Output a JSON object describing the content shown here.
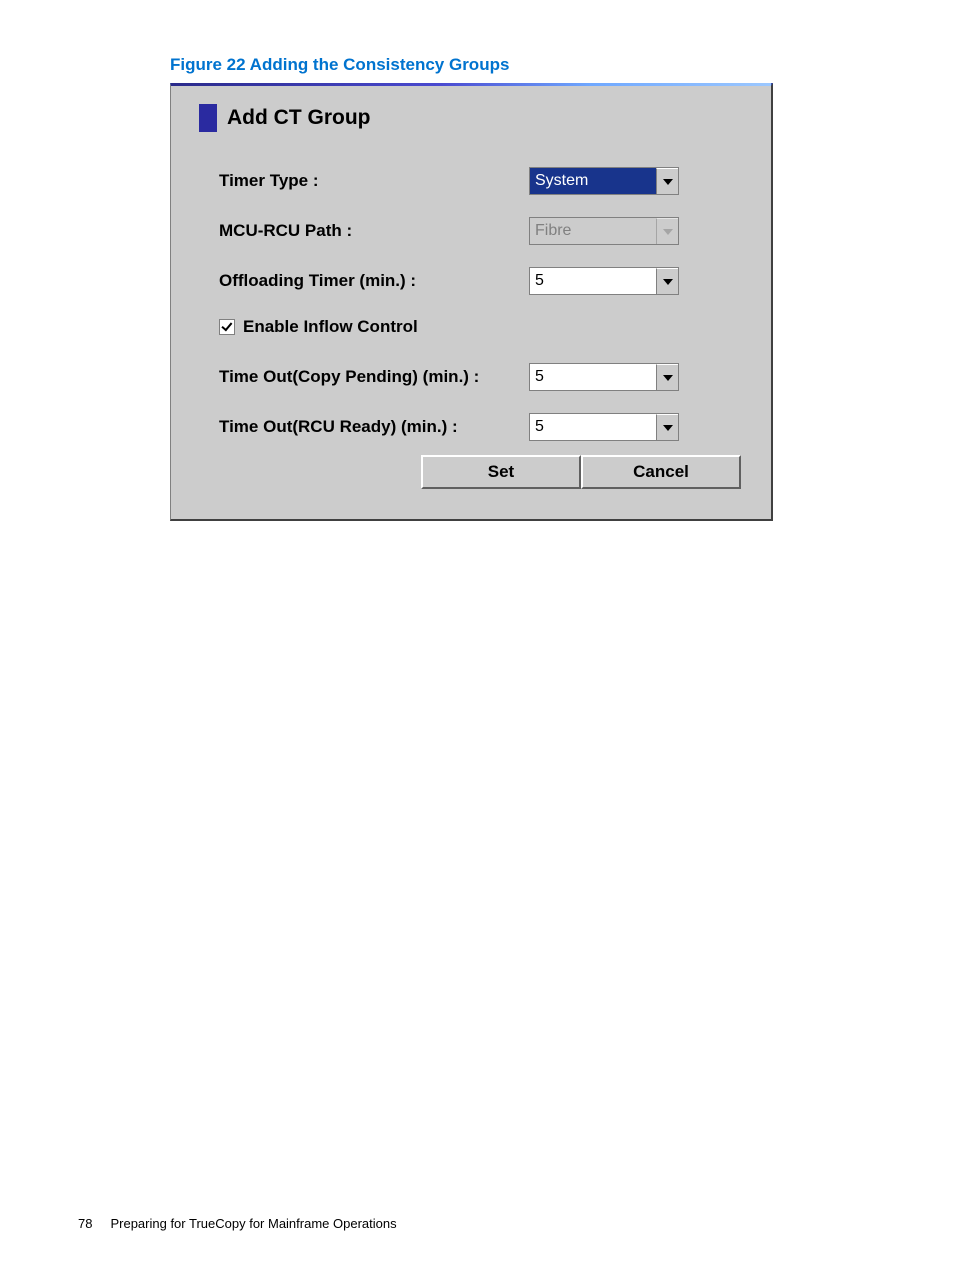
{
  "caption": "Figure 22 Adding the Consistency Groups",
  "dialog": {
    "title": "Add CT Group",
    "fields": {
      "timer_type_label": "Timer Type :",
      "timer_type_value": "System",
      "mcu_path_label": "MCU-RCU Path :",
      "mcu_path_value": "Fibre",
      "offloading_label": "Offloading Timer (min.) :",
      "offloading_value": "5",
      "enable_inflow_label": "Enable Inflow Control",
      "timeout_copy_label": "Time Out(Copy Pending) (min.) :",
      "timeout_copy_value": "5",
      "timeout_rcu_label": "Time Out(RCU Ready) (min.) :",
      "timeout_rcu_value": "5"
    },
    "buttons": {
      "set": "Set",
      "cancel": "Cancel"
    }
  },
  "footer": {
    "page_number": "78",
    "section": "Preparing for TrueCopy for Mainframe Operations"
  }
}
